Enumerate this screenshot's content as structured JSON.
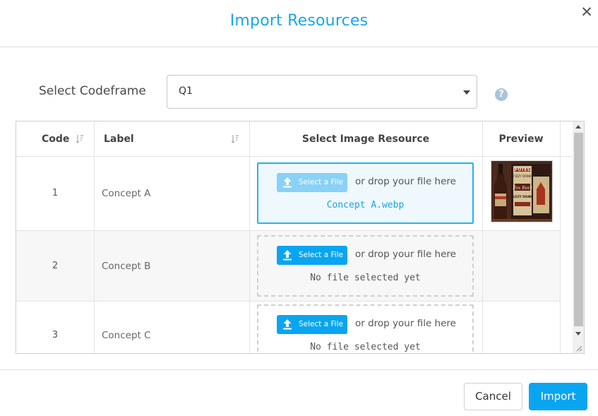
{
  "dialog": {
    "title": "Import Resources",
    "close_symbol": "✕"
  },
  "codeframe": {
    "label": "Select Codeframe",
    "value": "Q1",
    "help_symbol": "?"
  },
  "table": {
    "headers": {
      "code": "Code",
      "label": "Label",
      "image": "Select Image Resource",
      "preview": "Preview"
    },
    "rows": [
      {
        "code": "1",
        "label": "Concept A",
        "button": "Select a File",
        "drop_text": "or drop your file here",
        "file": "Concept A.webp"
      },
      {
        "code": "2",
        "label": "Concept B",
        "button": "Select a File",
        "drop_text": "or drop your file here",
        "file": "No file selected yet"
      },
      {
        "code": "3",
        "label": "Concept C",
        "button": "Select a File",
        "drop_text": "or drop your file here",
        "file": "No file selected yet"
      }
    ],
    "preview_image": {
      "description_colors": {
        "bottle": "#5a1f14",
        "label": "#d9c49a",
        "accent": "#c23a2a"
      },
      "text_lines": [
        "FOTES",
        "FIZZY DRINK",
        "Fox Beer",
        "SIZZY DRINK"
      ]
    }
  },
  "footer": {
    "cancel": "Cancel",
    "import": "Import"
  },
  "colors": {
    "accent": "#0aa5f0",
    "title": "#19a6e8"
  },
  "icons": {
    "sort": "sort-icon",
    "upload": "upload-icon",
    "close": "close-icon",
    "help": "help-icon"
  }
}
